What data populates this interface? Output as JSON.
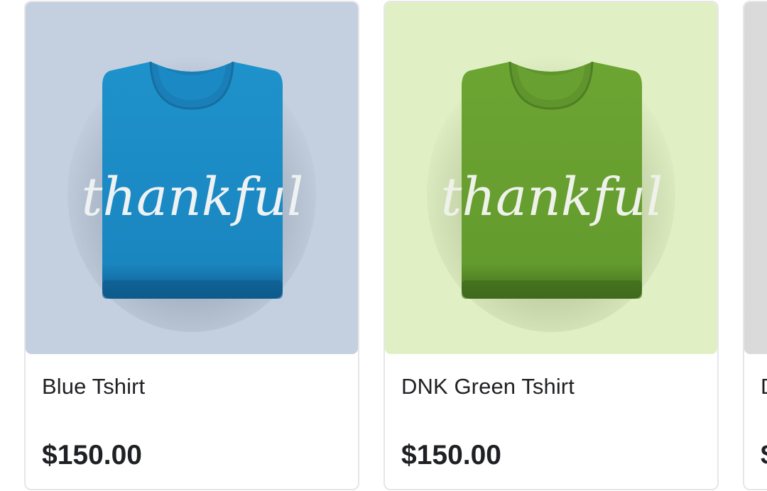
{
  "products": [
    {
      "name": "Blue Tshirt",
      "price": "$150.00",
      "print_text": "thankful",
      "colors": {
        "background": "#c4d0df",
        "shirt": "#1e92cc",
        "shirt_dark": "#0e5a8c"
      }
    },
    {
      "name": "DNK Green Tshirt",
      "price": "$150.00",
      "print_text": "thankful",
      "colors": {
        "background": "#e1f0c4",
        "shirt": "#6da533",
        "shirt_dark": "#3f6a1c"
      }
    },
    {
      "name": "D",
      "price": "$",
      "colors": {
        "background": "#e6e6e6"
      }
    }
  ]
}
